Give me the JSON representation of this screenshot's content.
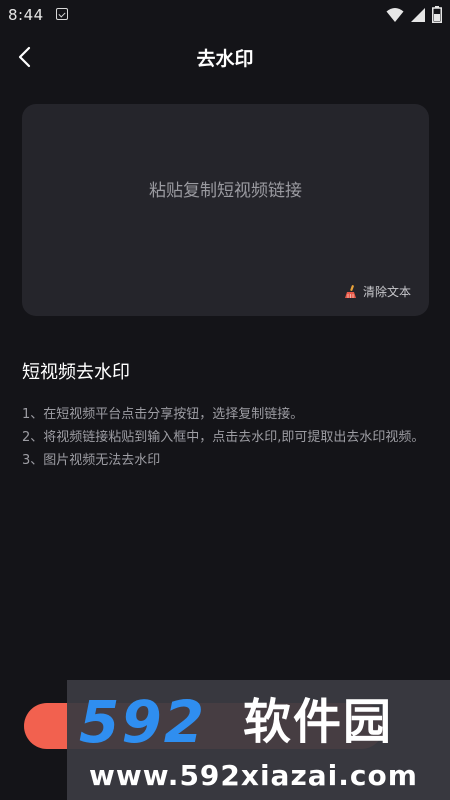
{
  "status_bar": {
    "time": "8:44"
  },
  "header": {
    "title": "去水印"
  },
  "paste_card": {
    "placeholder": "粘贴复制短视频链接",
    "clear_label": "清除文本"
  },
  "instructions": {
    "title": "短视频去水印",
    "steps": [
      "1、在短视频平台点击分享按钮，选择复制链接。",
      "2、将视频链接粘贴到输入框中，点击去水印,即可提取出去水印视频。",
      "3、图片视频无法去水印"
    ]
  },
  "watermark": {
    "logo_number": "592",
    "logo_text": "软件园",
    "url": "www.592xiazai.com"
  },
  "colors": {
    "background": "#141418",
    "card": "#25252b",
    "accent": "#f2614f",
    "watermark_blue": "#2f8ef0"
  }
}
